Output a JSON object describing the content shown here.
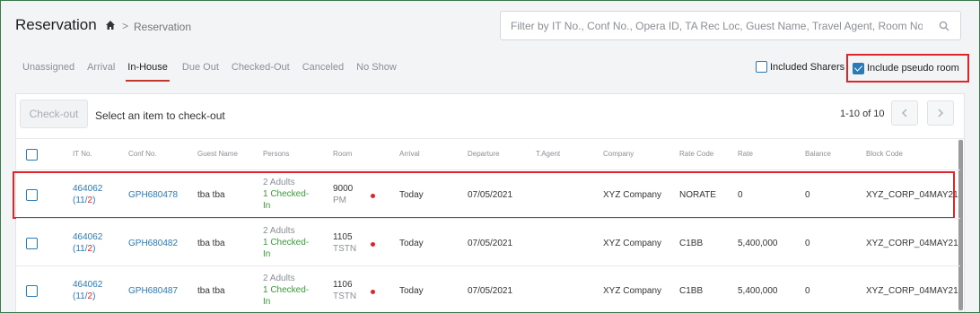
{
  "header": {
    "title": "Reservation",
    "breadcrumb_current": "Reservation",
    "search_placeholder": "Filter by IT No., Conf No., Opera ID, TA Rec Loc, Guest Name, Travel Agent, Room No."
  },
  "tabs": [
    "Unassigned",
    "Arrival",
    "In-House",
    "Due Out",
    "Checked-Out",
    "Canceled",
    "No Show"
  ],
  "active_tab": "In-House",
  "options": {
    "included_sharers": {
      "label": "Included Sharers",
      "checked": false
    },
    "include_pseudo_room": {
      "label": "Include pseudo room",
      "checked": true
    }
  },
  "toolbar": {
    "checkout_label": "Check-out",
    "hint": "Select an item to check-out",
    "pager_text": "1-10 of 10"
  },
  "columns": [
    "IT No.",
    "Conf No.",
    "Guest Name",
    "Persons",
    "Room",
    "Arrival",
    "Departure",
    "T.Agent",
    "Company",
    "Rate Code",
    "Rate",
    "Balance",
    "Block Code"
  ],
  "rows": [
    {
      "it_no": "464062",
      "it_sub_open": "(11/",
      "it_sub_red": "2",
      "it_sub_close": ")",
      "conf_no": "GPH680478",
      "guest": "tba tba",
      "persons_adults": "2 Adults",
      "persons_checked": "1 Checked-",
      "persons_in": "In",
      "room_no": "9000",
      "room_type": "PM",
      "arrival": "Today",
      "departure": "07/05/2021",
      "t_agent": "",
      "company": "XYZ Company",
      "rate_code": "NORATE",
      "rate": "0",
      "balance": "0",
      "block_code": "XYZ_CORP_04MAY21",
      "highlighted": true
    },
    {
      "it_no": "464062",
      "it_sub_open": "(11/",
      "it_sub_red": "2",
      "it_sub_close": ")",
      "conf_no": "GPH680482",
      "guest": "tba tba",
      "persons_adults": "2 Adults",
      "persons_checked": "1 Checked-",
      "persons_in": "In",
      "room_no": "1105",
      "room_type": "TSTN",
      "arrival": "Today",
      "departure": "07/05/2021",
      "t_agent": "",
      "company": "XYZ Company",
      "rate_code": "C1BB",
      "rate": "5,400,000",
      "balance": "0",
      "block_code": "XYZ_CORP_04MAY21",
      "highlighted": false
    },
    {
      "it_no": "464062",
      "it_sub_open": "(11/",
      "it_sub_red": "2",
      "it_sub_close": ")",
      "conf_no": "GPH680487",
      "guest": "tba tba",
      "persons_adults": "2 Adults",
      "persons_checked": "1 Checked-",
      "persons_in": "In",
      "room_no": "1106",
      "room_type": "TSTN",
      "arrival": "Today",
      "departure": "07/05/2021",
      "t_agent": "",
      "company": "XYZ Company",
      "rate_code": "C1BB",
      "rate": "5,400,000",
      "balance": "0",
      "block_code": "XYZ_CORP_04MAY21",
      "highlighted": false
    }
  ]
}
